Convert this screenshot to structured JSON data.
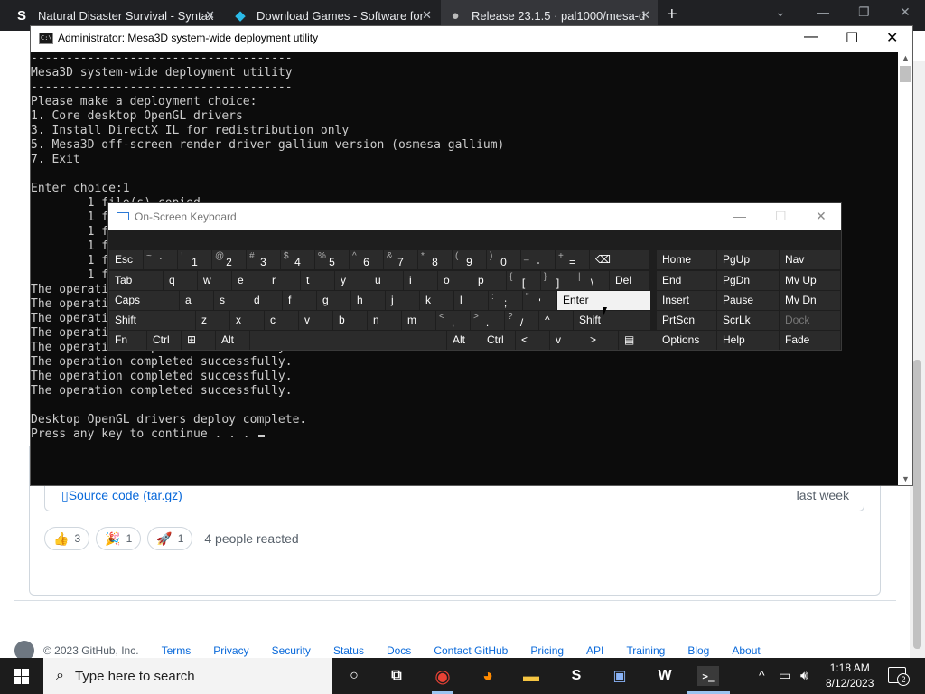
{
  "browser": {
    "tabs": [
      {
        "label": "Natural Disaster Survival - Syntax",
        "favicon": "S"
      },
      {
        "label": "Download Games - Software for",
        "favicon": "◆"
      },
      {
        "label": "Release 23.1.5 · pal1000/mesa-d",
        "favicon": "●"
      }
    ],
    "new_tab": "+",
    "close": "✕"
  },
  "page": {
    "asset": {
      "name": "Source code (tar.gz)",
      "date": "last week"
    },
    "reactions": [
      {
        "icon": "👍",
        "count": "3"
      },
      {
        "icon": "🎉",
        "count": "1"
      },
      {
        "icon": "🚀",
        "count": "1"
      }
    ],
    "reaction_summary": "4 people reacted",
    "footer": {
      "copyright": "© 2023 GitHub, Inc.",
      "links": [
        "Terms",
        "Privacy",
        "Security",
        "Status",
        "Docs",
        "Contact GitHub",
        "Pricing",
        "API",
        "Training",
        "Blog",
        "About"
      ]
    }
  },
  "console": {
    "title": "Administrator:  Mesa3D system-wide deployment utility",
    "icon_text": "C:\\",
    "lines": [
      "-------------------------------------",
      "Mesa3D system-wide deployment utility",
      "-------------------------------------",
      "Please make a deployment choice:",
      "1. Core desktop OpenGL drivers",
      "3. Install DirectX IL for redistribution only",
      "5. Mesa3D off-screen render driver gallium version (osmesa gallium)",
      "7. Exit",
      "",
      "Enter choice:1",
      "        1 file(s) copied.",
      "        1 file(s) copied.",
      "        1 file(s) copied.",
      "        1 file(s) copied.",
      "        1 file(s) copied.",
      "        1 file(s) copied.",
      "The operation completed successfully.",
      "The operation completed successfully.",
      "The operation completed successfully.",
      "The operation completed successfully.",
      "The operation completed successfully.",
      "The operation completed successfully.",
      "The operation completed successfully.",
      "The operation completed successfully.",
      "",
      "Desktop OpenGL drivers deploy complete.",
      "Press any key to continue . . . "
    ]
  },
  "osk": {
    "title": "On-Screen Keyboard",
    "rows": [
      [
        {
          "l": "Esc"
        },
        {
          "s": "~",
          "l": "`"
        },
        {
          "s": "!",
          "l": "1"
        },
        {
          "s": "@",
          "l": "2"
        },
        {
          "s": "#",
          "l": "3"
        },
        {
          "s": "$",
          "l": "4"
        },
        {
          "s": "%",
          "l": "5"
        },
        {
          "s": "^",
          "l": "6"
        },
        {
          "s": "&",
          "l": "7"
        },
        {
          "s": "*",
          "l": "8"
        },
        {
          "s": "(",
          "l": "9"
        },
        {
          "s": ")",
          "l": "0"
        },
        {
          "s": "_",
          "l": "-"
        },
        {
          "s": "+",
          "l": "="
        },
        {
          "l": "⌫"
        }
      ],
      [
        {
          "l": "Tab"
        },
        {
          "l": "q"
        },
        {
          "l": "w"
        },
        {
          "l": "e"
        },
        {
          "l": "r"
        },
        {
          "l": "t"
        },
        {
          "l": "y"
        },
        {
          "l": "u"
        },
        {
          "l": "i"
        },
        {
          "l": "o"
        },
        {
          "l": "p"
        },
        {
          "s": "{",
          "l": "["
        },
        {
          "s": "}",
          "l": "]"
        },
        {
          "s": "|",
          "l": "\\"
        },
        {
          "l": "Del"
        }
      ],
      [
        {
          "l": "Caps"
        },
        {
          "l": "a"
        },
        {
          "l": "s"
        },
        {
          "l": "d"
        },
        {
          "l": "f"
        },
        {
          "l": "g"
        },
        {
          "l": "h"
        },
        {
          "l": "j"
        },
        {
          "l": "k"
        },
        {
          "l": "l"
        },
        {
          "s": ":",
          "l": ";"
        },
        {
          "s": "\"",
          "l": "'"
        },
        {
          "l": "Enter"
        }
      ],
      [
        {
          "l": "Shift"
        },
        {
          "l": "z"
        },
        {
          "l": "x"
        },
        {
          "l": "c"
        },
        {
          "l": "v"
        },
        {
          "l": "b"
        },
        {
          "l": "n"
        },
        {
          "l": "m"
        },
        {
          "s": "<",
          "l": ","
        },
        {
          "s": ">",
          "l": "."
        },
        {
          "s": "?",
          "l": "/"
        },
        {
          "l": "^"
        },
        {
          "l": "Shift"
        }
      ],
      [
        {
          "l": "Fn"
        },
        {
          "l": "Ctrl"
        },
        {
          "l": "⊞"
        },
        {
          "l": "Alt"
        },
        {
          "l": ""
        },
        {
          "l": "Alt"
        },
        {
          "l": "Ctrl"
        },
        {
          "l": "<"
        },
        {
          "l": "v"
        },
        {
          "l": ">"
        },
        {
          "l": "▤"
        }
      ]
    ],
    "nav": [
      [
        "Home",
        "PgUp",
        "Nav"
      ],
      [
        "End",
        "PgDn",
        "Mv Up"
      ],
      [
        "Insert",
        "Pause",
        "Mv Dn"
      ],
      [
        "PrtScn",
        "ScrLk",
        "Dock"
      ],
      [
        "Options",
        "Help",
        "Fade"
      ]
    ]
  },
  "taskbar": {
    "search_placeholder": "Type here to search",
    "time": "1:18 AM",
    "date": "8/12/2023",
    "notification_count": "2",
    "apps": [
      "task-view",
      "chrome",
      "firefox",
      "file-explorer",
      "syntax",
      "monitor",
      "wine",
      "terminal"
    ]
  }
}
